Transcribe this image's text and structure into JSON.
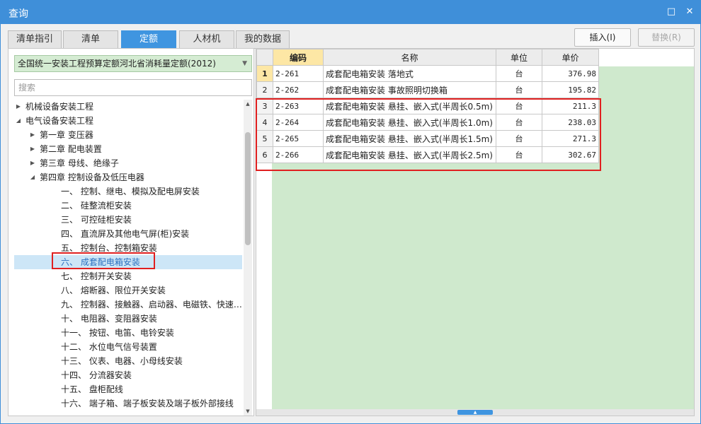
{
  "window": {
    "title": "查询",
    "restore_glyph": "□",
    "close_glyph": "✕"
  },
  "tabs": [
    {
      "label": "清单指引",
      "active": false
    },
    {
      "label": "清单",
      "active": false
    },
    {
      "label": "定额",
      "active": true
    },
    {
      "label": "人材机",
      "active": false
    },
    {
      "label": "我的数据",
      "active": false
    }
  ],
  "actions": {
    "insert": "插入(I)",
    "replace": "替换(R)"
  },
  "library": {
    "selected": "全国统一安装工程预算定额河北省消耗量定额(2012)"
  },
  "search": {
    "placeholder": "搜索",
    "value": ""
  },
  "tree": [
    {
      "label": "机械设备安装工程",
      "toggle": "collapsed"
    },
    {
      "label": "电气设备安装工程",
      "toggle": "expanded"
    },
    {
      "label": "第一章 变压器",
      "toggle": "collapsed"
    },
    {
      "label": "第二章 配电装置",
      "toggle": "collapsed"
    },
    {
      "label": "第三章 母线、绝缘子",
      "toggle": "collapsed"
    },
    {
      "label": "第四章 控制设备及低压电器",
      "toggle": "expanded"
    },
    {
      "label": "一、 控制、继电、模拟及配电屏安装",
      "toggle": "none"
    },
    {
      "label": "二、 硅整流柜安装",
      "toggle": "none"
    },
    {
      "label": "三、 可控硅柜安装",
      "toggle": "none"
    },
    {
      "label": "四、 直流屏及其他电气屏(柜)安装",
      "toggle": "none"
    },
    {
      "label": "五、 控制台、控制箱安装",
      "toggle": "none"
    },
    {
      "label": "六、 成套配电箱安装",
      "toggle": "none",
      "selected": true
    },
    {
      "label": "七、 控制开关安装",
      "toggle": "none"
    },
    {
      "label": "八、 熔断器、限位开关安装",
      "toggle": "none"
    },
    {
      "label": "九、 控制器、接触器、启动器、电磁铁、快速…",
      "toggle": "none"
    },
    {
      "label": "十、 电阻器、变阻器安装",
      "toggle": "none"
    },
    {
      "label": "十一、 按钮、电笛、电铃安装",
      "toggle": "none"
    },
    {
      "label": "十二、 水位电气信号装置",
      "toggle": "none"
    },
    {
      "label": "十三、 仪表、电器、小母线安装",
      "toggle": "none"
    },
    {
      "label": "十四、 分流器安装",
      "toggle": "none"
    },
    {
      "label": "十五、 盘柜配线",
      "toggle": "none"
    },
    {
      "label": "十六、 端子箱、端子板安装及端子板外部接线",
      "toggle": "none"
    }
  ],
  "table": {
    "columns": [
      "编码",
      "名称",
      "单位",
      "单价"
    ],
    "rows": [
      {
        "idx": "1",
        "code": "2-261",
        "name": "成套配电箱安装 落地式",
        "unit": "台",
        "price": "376.98"
      },
      {
        "idx": "2",
        "code": "2-262",
        "name": "成套配电箱安装 事故照明切换箱",
        "unit": "台",
        "price": "195.82"
      },
      {
        "idx": "3",
        "code": "2-263",
        "name": "成套配电箱安装 悬挂、嵌入式(半周长0.5m)",
        "unit": "台",
        "price": "211.3"
      },
      {
        "idx": "4",
        "code": "2-264",
        "name": "成套配电箱安装 悬挂、嵌入式(半周长1.0m)",
        "unit": "台",
        "price": "238.03"
      },
      {
        "idx": "5",
        "code": "2-265",
        "name": "成套配电箱安装 悬挂、嵌入式(半周长1.5m)",
        "unit": "台",
        "price": "271.3"
      },
      {
        "idx": "6",
        "code": "2-266",
        "name": "成套配电箱安装 悬挂、嵌入式(半周长2.5m)",
        "unit": "台",
        "price": "302.67"
      }
    ]
  },
  "colors": {
    "titlebar": "#3f8fd9",
    "active_tab": "#3f95e0",
    "highlight": "#e02020",
    "grid_bg": "#cfe9cd",
    "library_bg": "#d5ecd3"
  }
}
